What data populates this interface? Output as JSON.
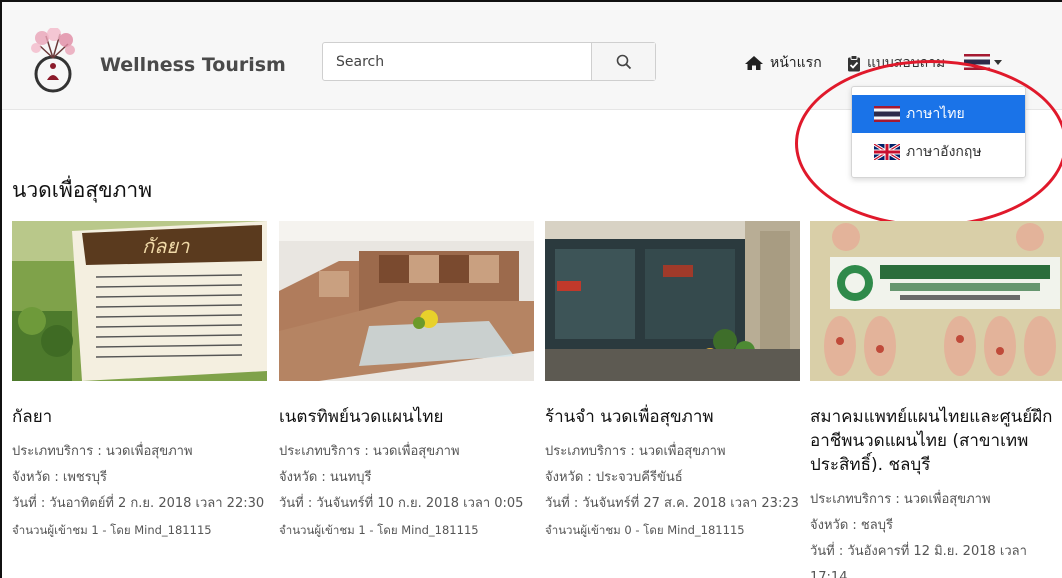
{
  "brand": {
    "name": "Wellness Tourism"
  },
  "search": {
    "placeholder": "Search"
  },
  "nav": {
    "home": "หน้าแรก",
    "questionnaire": "แบบสอบถาม"
  },
  "language_menu": {
    "items": [
      {
        "label": "ภาษาไทย",
        "flag": "thai-flag-icon",
        "selected": true
      },
      {
        "label": "ภาษาอังกฤษ",
        "flag": "uk-flag-icon",
        "selected": false
      }
    ]
  },
  "colors": {
    "accent": "#1a73e8",
    "annotation": "#e0192b"
  },
  "section": {
    "title": "นวดเพื่อสุขภาพ"
  },
  "cards": [
    {
      "title": "กัลยา",
      "type": "ประเภทบริการ : นวดเพื่อสุขภาพ",
      "province": "จังหวัด : เพชรบุรี",
      "date": "วันที่ : วันอาทิตย์ที่ 2 ก.ย. 2018 เวลา 22:30",
      "views": "จำนวนผู้เข้าชม 1 - โดย Mind_181115"
    },
    {
      "title": "เนตรทิพย์นวดแผนไทย",
      "type": "ประเภทบริการ : นวดเพื่อสุขภาพ",
      "province": "จังหวัด : นนทบุรี",
      "date": "วันที่ : วันจันทร์ที่ 10 ก.ย. 2018 เวลา 0:05",
      "views": "จำนวนผู้เข้าชม 1 - โดย Mind_181115"
    },
    {
      "title": "ร้านจำ นวดเพื่อสุขภาพ",
      "type": "ประเภทบริการ : นวดเพื่อสุขภาพ",
      "province": "จังหวัด : ประจวบคีรีขันธ์",
      "date": "วันที่ : วันจันทร์ที่ 27 ส.ค. 2018 เวลา 23:23",
      "views": "จำนวนผู้เข้าชม 0 - โดย Mind_181115"
    },
    {
      "title": "สมาคมแพทย์แผนไทยและศูนย์ฝึกอาชีพนวดแผนไทย (สาขาเทพประสิทธิ์). ชลบุรี",
      "type": "ประเภทบริการ : นวดเพื่อสุขภาพ",
      "province": "จังหวัด : ชลบุรี",
      "date": "วันที่ : วันอังคารที่ 12 มิ.ย. 2018 เวลา 17:14",
      "views": ""
    }
  ]
}
